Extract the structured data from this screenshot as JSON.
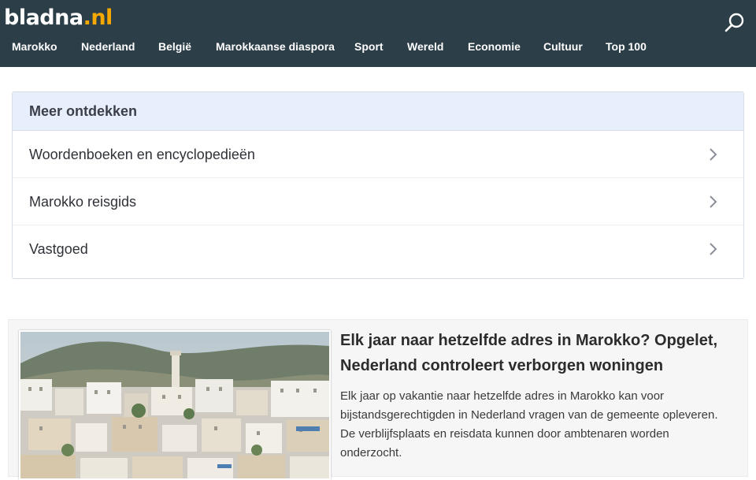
{
  "header": {
    "logo_main": "bladna",
    "logo_tld": ".nl",
    "search_icon": "search-icon",
    "colors": {
      "background": "#2c3e48",
      "accent": "#f5a800"
    }
  },
  "nav": {
    "items": [
      {
        "label": "Marokko"
      },
      {
        "label": "Nederland"
      },
      {
        "label": "België"
      },
      {
        "label": "Marokkaanse diaspora"
      },
      {
        "label": "Sport"
      },
      {
        "label": "Wereld"
      },
      {
        "label": "Economie"
      },
      {
        "label": "Cultuur"
      },
      {
        "label": "Top 100"
      }
    ]
  },
  "discover": {
    "title": "Meer ontdekken",
    "chevron_icon": "chevron-right-icon",
    "items": [
      {
        "label": "Woordenboeken en encyclopedieën"
      },
      {
        "label": "Marokko reisgids"
      },
      {
        "label": "Vastgoed"
      }
    ]
  },
  "article": {
    "headline": "Elk jaar naar hetzelfde adres in Marokko? Opgelet, Nederland controleert verborgen woningen",
    "summary": "Elk jaar op vakantie naar hetzelfde adres in Marokko kan voor bijstandsgerechtigden in Nederland vragen van de gemeente opleveren. De verblijfsplaats en reisdata kunnen door ambtenaren worden onderzocht."
  }
}
